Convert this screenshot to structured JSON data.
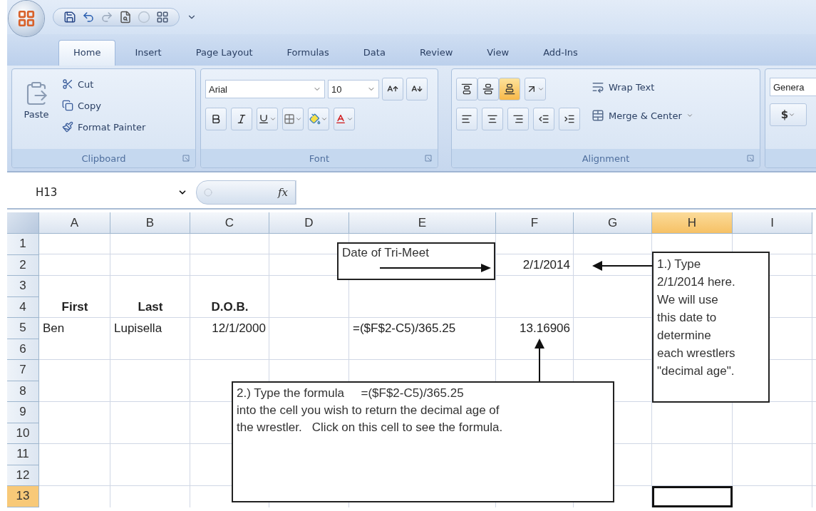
{
  "tabs": [
    {
      "label": "Home",
      "selected": true
    },
    {
      "label": "Insert",
      "selected": false
    },
    {
      "label": "Page Layout",
      "selected": false
    },
    {
      "label": "Formulas",
      "selected": false
    },
    {
      "label": "Data",
      "selected": false
    },
    {
      "label": "Review",
      "selected": false
    },
    {
      "label": "View",
      "selected": false
    },
    {
      "label": "Add-Ins",
      "selected": false
    }
  ],
  "ribbon": {
    "clipboard": {
      "title": "Clipboard",
      "paste": "Paste",
      "actions": [
        {
          "kind": "cut",
          "label": "Cut"
        },
        {
          "kind": "copy",
          "label": "Copy"
        },
        {
          "kind": "painter",
          "label": "Format Painter"
        }
      ]
    },
    "font": {
      "title": "Font",
      "font_name": "Arial",
      "font_size": "10"
    },
    "alignment": {
      "title": "Alignment",
      "vertical": [
        {
          "kind": "top",
          "selected": false
        },
        {
          "kind": "middle",
          "selected": false
        },
        {
          "kind": "bottom",
          "selected": true
        }
      ],
      "wrap_text": "Wrap Text",
      "merge": "Merge & Center"
    },
    "number": {
      "format": "Genera",
      "currency": "$"
    }
  },
  "formula_bar": {
    "name_box": "H13",
    "function_label": "fx"
  },
  "sheet": {
    "columns": [
      {
        "label": "A",
        "selected": false
      },
      {
        "label": "B",
        "selected": false
      },
      {
        "label": "C",
        "selected": false
      },
      {
        "label": "D",
        "selected": false
      },
      {
        "label": "E",
        "selected": false
      },
      {
        "label": "F",
        "selected": false
      },
      {
        "label": "G",
        "selected": false
      },
      {
        "label": "H",
        "selected": true
      },
      {
        "label": "I",
        "selected": false
      }
    ],
    "rows": [
      {
        "label": "1",
        "selected": false
      },
      {
        "label": "2",
        "selected": false,
        "cells": {
          "F": {
            "text": "2/1/2014",
            "kind": "number"
          }
        }
      },
      {
        "label": "3",
        "selected": false
      },
      {
        "label": "4",
        "selected": false,
        "cells": {
          "A": {
            "text": "First",
            "kind": "header"
          },
          "B": {
            "text": "Last",
            "kind": "header"
          },
          "C": {
            "text": "D.O.B.",
            "kind": "header"
          }
        }
      },
      {
        "label": "5",
        "selected": false,
        "cells": {
          "A": {
            "text": "Ben",
            "kind": "text"
          },
          "B": {
            "text": "Lupisella",
            "kind": "text"
          },
          "C": {
            "text": "12/1/2000",
            "kind": "number"
          },
          "E": {
            "text": "=($F$2-C5)/365.25",
            "kind": "text"
          },
          "F": {
            "text": "13.16906",
            "kind": "number"
          }
        }
      },
      {
        "label": "6",
        "selected": false
      },
      {
        "label": "7",
        "selected": false
      },
      {
        "label": "8",
        "selected": false
      },
      {
        "label": "9",
        "selected": false
      },
      {
        "label": "10",
        "selected": false
      },
      {
        "label": "11",
        "selected": false
      },
      {
        "label": "12",
        "selected": false
      },
      {
        "label": "13",
        "selected": true
      }
    ]
  },
  "notes": [
    {
      "kind": "arrow_inside",
      "text": "Date of Tri-Meet"
    },
    {
      "kind": "pointer_left",
      "text": "1.) Type\n2/1/2014 here.\nWe will use\nthis date to\ndetermine\neach wrestlers\n\"decimal age\"."
    },
    {
      "kind": "pointer_up",
      "text": "2.) Type the formula     =($F$2-C5)/365.25\ninto the cell you wish to return the decimal age of\nthe wrestler.   Click on this cell to see the formula."
    }
  ]
}
